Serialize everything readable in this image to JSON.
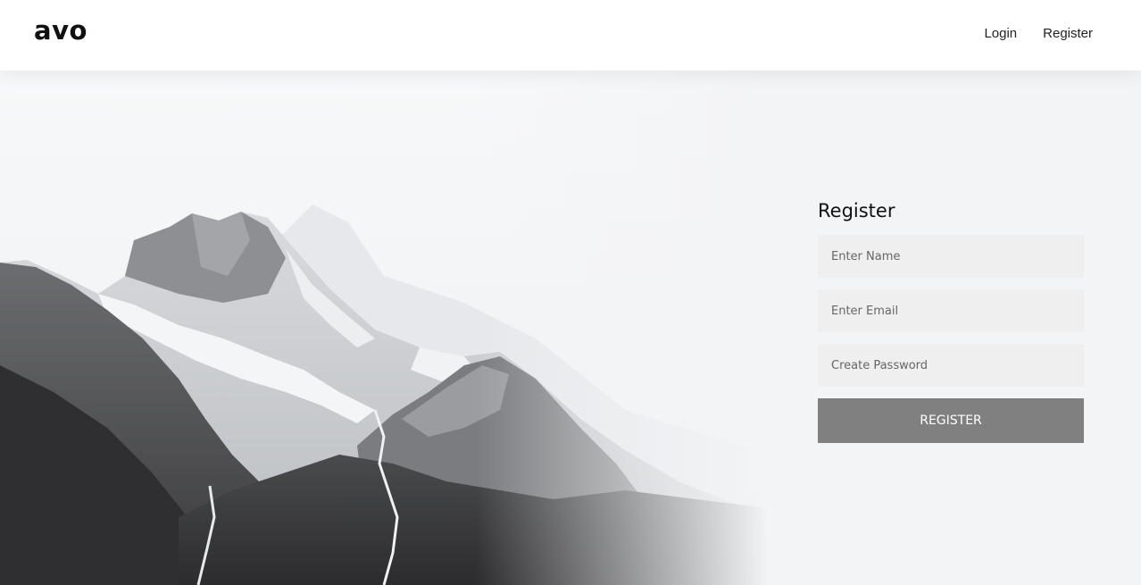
{
  "brand": {
    "logo_text": "avo"
  },
  "nav": {
    "login_label": "Login",
    "register_label": "Register"
  },
  "form": {
    "title": "Register",
    "name_placeholder": "Enter Name",
    "email_placeholder": "Enter Email",
    "password_placeholder": "Create Password",
    "submit_label": "REGISTER"
  },
  "colors": {
    "background": "#f3f4f6",
    "navbar": "#ffffff",
    "input_bg": "#efefef",
    "button_bg": "#808080"
  }
}
